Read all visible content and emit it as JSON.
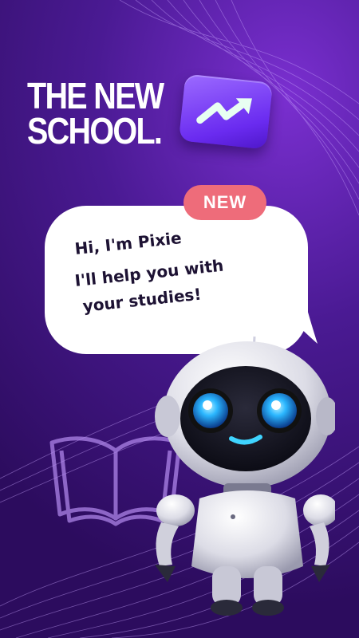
{
  "brand": {
    "line1": "THE NEW",
    "line2": "SCHOOL.",
    "chip_icon": "trend-arrow-icon"
  },
  "speech": {
    "badge": "NEW",
    "greeting": "Hi, I'm Pixie",
    "message_line1": "I'll help you with",
    "message_line2": "your studies!"
  },
  "colors": {
    "background": "#4a1a93",
    "badge": "#ee6c7a",
    "chip": "#7b3cf5",
    "robot_eyes": "#2bb7ff"
  },
  "icons": [
    "open-book-icon",
    "robot-mascot"
  ]
}
